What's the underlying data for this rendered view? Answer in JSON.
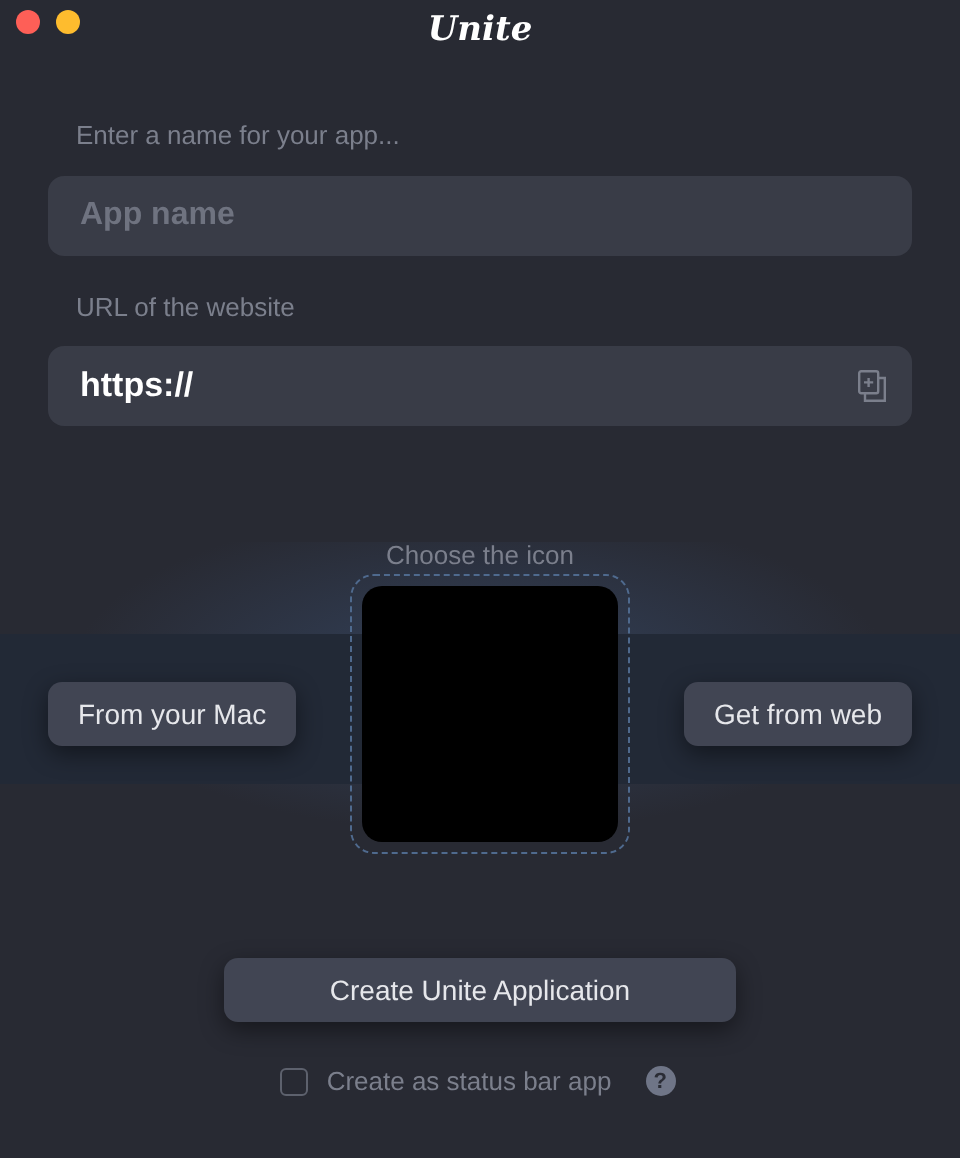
{
  "window": {
    "title": "Unite",
    "traffic_lights": [
      {
        "color": "#fe5f57"
      },
      {
        "color": "#febc2e"
      }
    ]
  },
  "name_field": {
    "label": "Enter a name for your app...",
    "placeholder": "App name"
  },
  "url_field": {
    "label": "URL of the website",
    "value": "https://"
  },
  "icon_picker": {
    "label": "Choose the icon",
    "buttons": [
      "From your Mac",
      "Get from web"
    ]
  },
  "create_button": "Create Unite Application",
  "status_bar_option": {
    "label": "Create as status bar app",
    "checked": false,
    "help": "?"
  }
}
